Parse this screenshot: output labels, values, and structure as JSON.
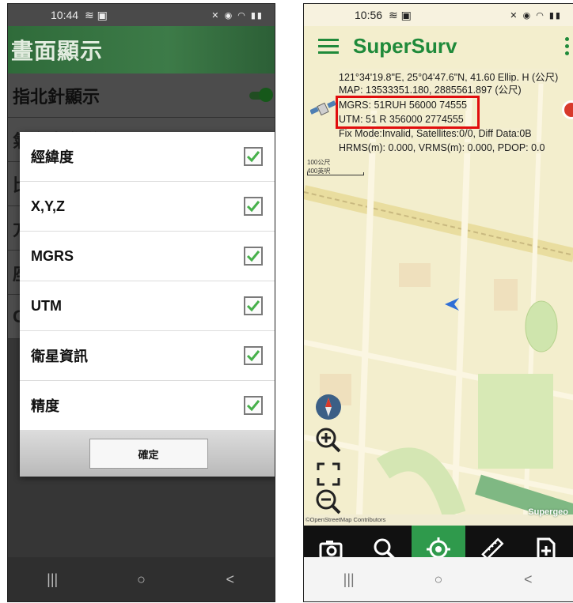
{
  "left_screen": {
    "status": {
      "time": "10:44",
      "icons": "⚑ ⚐ ☷ ▣"
    },
    "header_title": "畫面顯示",
    "settings": [
      {
        "label": "指北針顯示",
        "toggle": true
      },
      {
        "label": "氣泡水準儀",
        "toggle": false
      },
      {
        "label": "比",
        "toggle": true
      },
      {
        "label": "方",
        "toggle": false
      },
      {
        "label": "座",
        "toggle": false
      },
      {
        "label": "C",
        "toggle": false
      }
    ],
    "dialog": {
      "items": [
        {
          "label": "經緯度",
          "checked": true
        },
        {
          "label": "X,Y,Z",
          "checked": true
        },
        {
          "label": "MGRS",
          "checked": true
        },
        {
          "label": "UTM",
          "checked": true
        },
        {
          "label": "衛星資訊",
          "checked": true
        },
        {
          "label": "精度",
          "checked": true
        }
      ],
      "ok_label": "確定"
    },
    "nav": {
      "recents": "|||",
      "home": "○",
      "back": "<"
    }
  },
  "right_screen": {
    "status": {
      "time": "10:56",
      "icons": "⚑ ⚐ ☷ ▣"
    },
    "app_title": "SuperSurv",
    "info": {
      "latlon": "121°34'19.8\"E, 25°04'47.6\"N, 41.60 Ellip. H (公尺)",
      "map": "MAP: 13533351.180, 2885561.897 (公尺)",
      "mgrs": "MGRS: 51RUH 56000 74555",
      "utm": "UTM: 51 R 356000 2774555",
      "fix": "Fix Mode:Invalid, Satellites:0/0, Diff Data:0B",
      "hrms": "HRMS(m): 0.000, VRMS(m): 0.000, PDOP: 0.0"
    },
    "scale": {
      "top": "100公尺",
      "bottom": "400英呎"
    },
    "attribution": "©OpenStreetMap Contributors",
    "brand": "Supergeo",
    "nav": {
      "recents": "|||",
      "home": "○",
      "back": "<"
    },
    "colors": {
      "accent": "#1f8a3a",
      "highlight": "#e10d0d",
      "toolbar_active": "#2f9a4c"
    }
  }
}
